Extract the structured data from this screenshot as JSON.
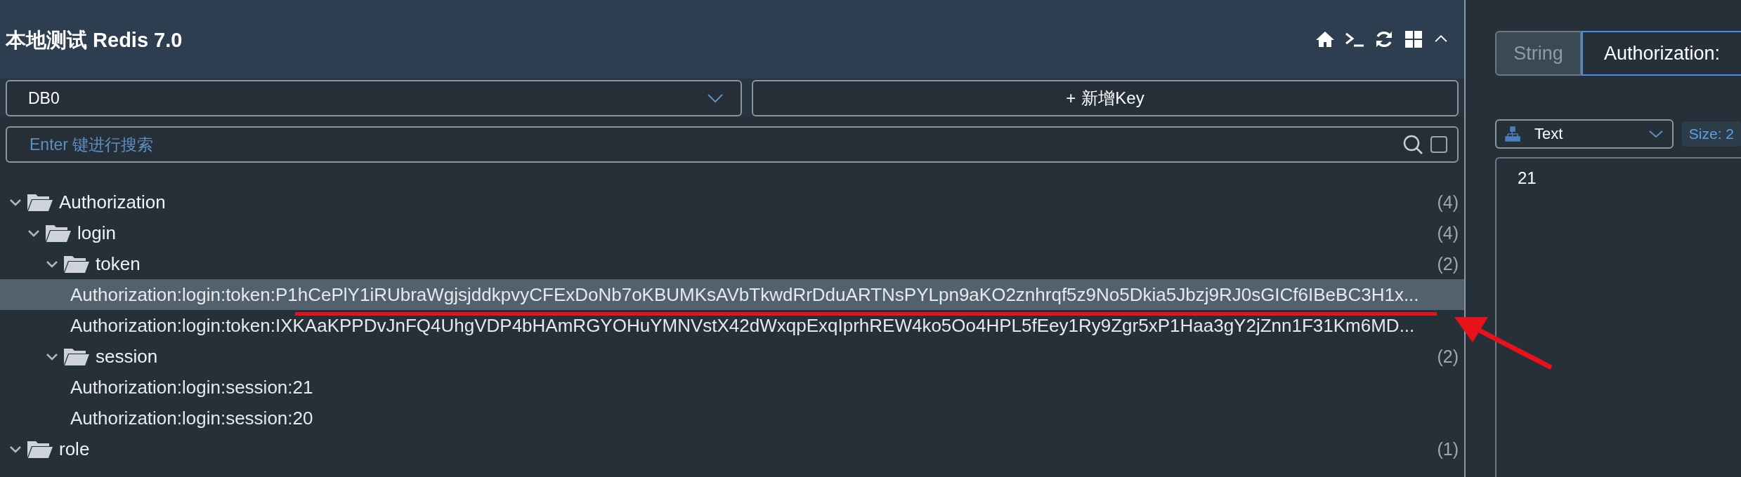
{
  "header": {
    "title": "本地测试 Redis 7.0"
  },
  "db_select": {
    "value": "DB0"
  },
  "add_key_button": {
    "icon": "+",
    "label": "新增Key"
  },
  "search": {
    "placeholder": "Enter 键进行搜索",
    "exact_match": false
  },
  "tree": [
    {
      "label": "Authorization",
      "count": "(4)",
      "expanded": true,
      "children": [
        {
          "label": "login",
          "count": "(4)",
          "expanded": true,
          "children": [
            {
              "label": "token",
              "count": "(2)",
              "expanded": true,
              "children": [
                {
                  "label": "Authorization:login:token:P1hCePlY1iRUbraWgjsjddkpvyCFExDoNb7oKBUMKsAVbTkwdRrDduARTNsPYLpn9aKO2znhrqf5z9No5Dkia5Jbzj9RJ0sGICf6IBeBC3H1x...",
                  "selected": true
                },
                {
                  "label": "Authorization:login:token:IXKAaKPPDvJnFQ4UhgVDP4bHAmRGYOHuYMNVstX42dWxqpExqIprhREW4ko5Oo4HPL5fEey1Ry9Zgr5xP1Haa3gY2jZnn1F31Km6MD...",
                  "selected": false
                }
              ]
            },
            {
              "label": "session",
              "count": "(2)",
              "expanded": true,
              "children": [
                {
                  "label": "Authorization:login:session:21",
                  "selected": false
                },
                {
                  "label": "Authorization:login:session:20",
                  "selected": false
                }
              ]
            }
          ]
        }
      ]
    },
    {
      "label": "role",
      "count": "(1)",
      "expanded": true
    }
  ],
  "detail": {
    "tabs": [
      {
        "label": "String",
        "selected": false
      },
      {
        "label": "Authorization:",
        "selected": true
      }
    ],
    "format_select": {
      "value": "Text"
    },
    "size_badge": "Size: 2",
    "value": "21"
  }
}
